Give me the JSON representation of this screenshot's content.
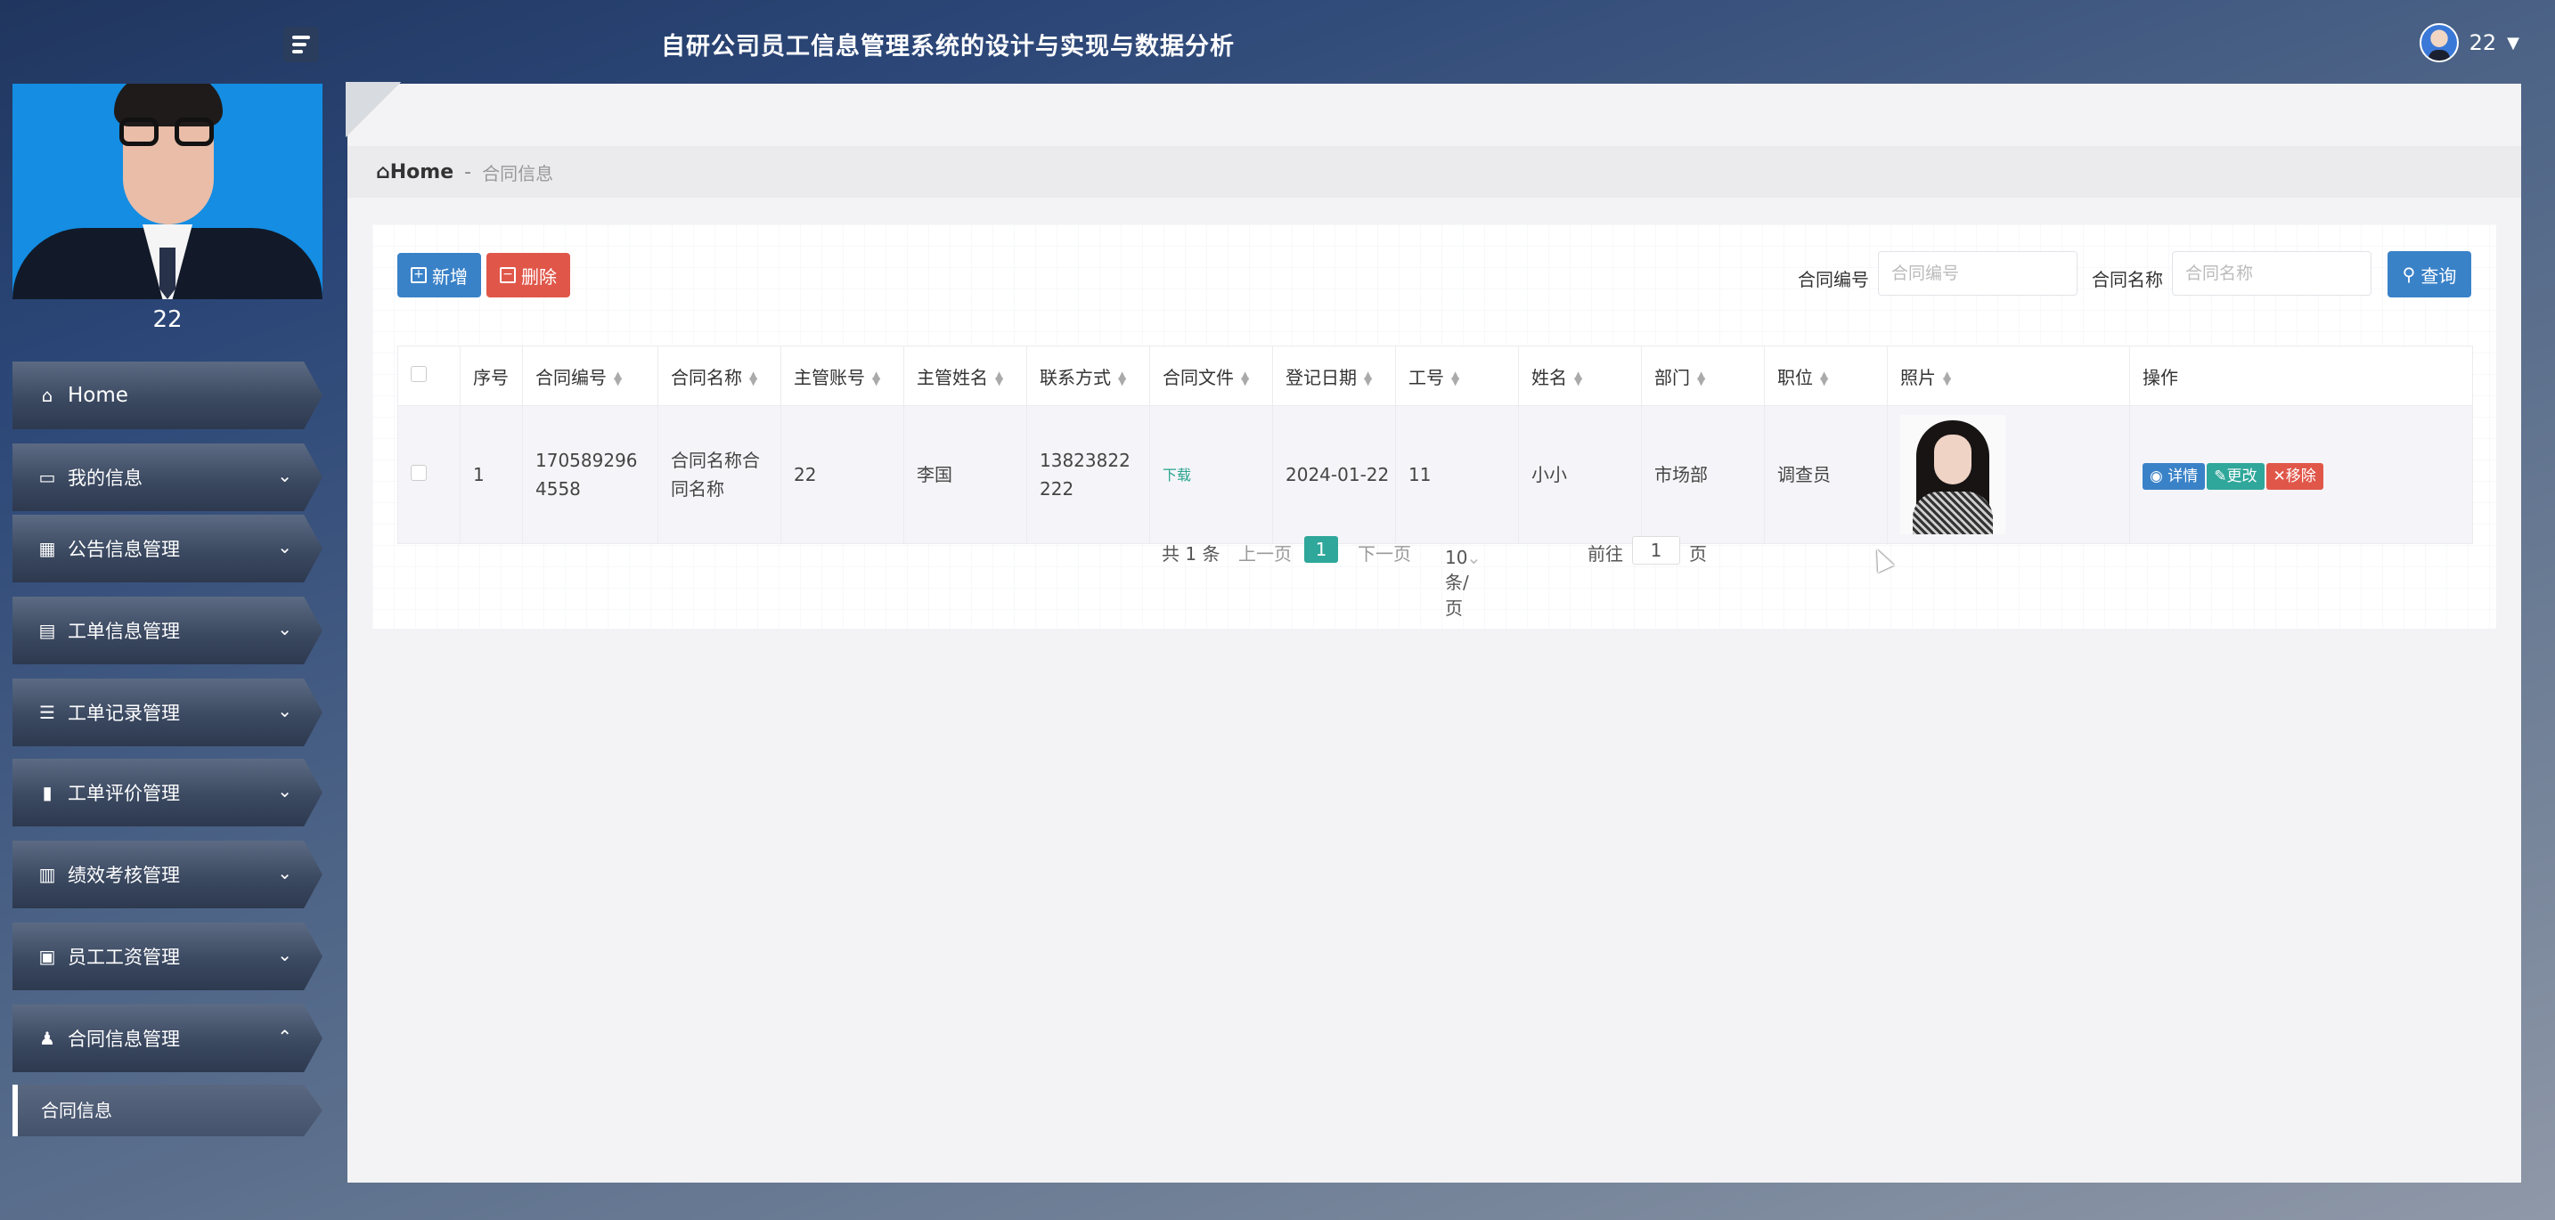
{
  "app": {
    "title": "自研公司员工信息管理系统的设计与实现与数据分析"
  },
  "user": {
    "name": "22"
  },
  "sidebar": {
    "profile_name": "22",
    "items": [
      {
        "label": "Home",
        "icon": "home-icon"
      },
      {
        "label": "我的信息",
        "icon": "id-card-icon"
      },
      {
        "label": "公告信息管理",
        "icon": "grid-icon"
      },
      {
        "label": "工单信息管理",
        "icon": "clipboard-icon"
      },
      {
        "label": "工单记录管理",
        "icon": "list-icon"
      },
      {
        "label": "工单评价管理",
        "icon": "book-icon"
      },
      {
        "label": "绩效考核管理",
        "icon": "bar-chart-icon"
      },
      {
        "label": "员工工资管理",
        "icon": "wallet-icon"
      },
      {
        "label": "合同信息管理",
        "icon": "user-icon"
      }
    ],
    "submenu": {
      "label": "合同信息"
    }
  },
  "breadcrumb": {
    "home": "Home",
    "separator": "-",
    "current": "合同信息"
  },
  "toolbar": {
    "add_label": "新增",
    "delete_label": "删除",
    "search_contract_no_label": "合同编号",
    "search_contract_no_placeholder": "合同编号",
    "search_contract_name_label": "合同名称",
    "search_contract_name_placeholder": "合同名称",
    "query_label": "查询"
  },
  "table": {
    "headers": [
      "序号",
      "合同编号",
      "合同名称",
      "主管账号",
      "主管姓名",
      "联系方式",
      "合同文件",
      "登记日期",
      "工号",
      "姓名",
      "部门",
      "职位",
      "照片",
      "操作"
    ],
    "rows": [
      {
        "index": "1",
        "contract_no": "1705892964558",
        "contract_name": "合同名称合同名称",
        "manager_account": "22",
        "manager_name": "李国",
        "contact": "13823822222",
        "file": "下载",
        "date": "2024-01-22",
        "emp_no": "11",
        "name": "小小",
        "dept": "市场部",
        "position": "调查员"
      }
    ],
    "actions": {
      "view": "详情",
      "edit": "更改",
      "remove": "移除"
    }
  },
  "pagination": {
    "total": "共 1 条",
    "prev": "上一页",
    "page": "1",
    "next": "下一页",
    "page_size": "10条/页",
    "goto_label": "前往",
    "goto_value": "1",
    "goto_unit": "页"
  },
  "colors": {
    "primary": "#3a82c8",
    "danger": "#e0574a",
    "success": "#2fa79a"
  }
}
